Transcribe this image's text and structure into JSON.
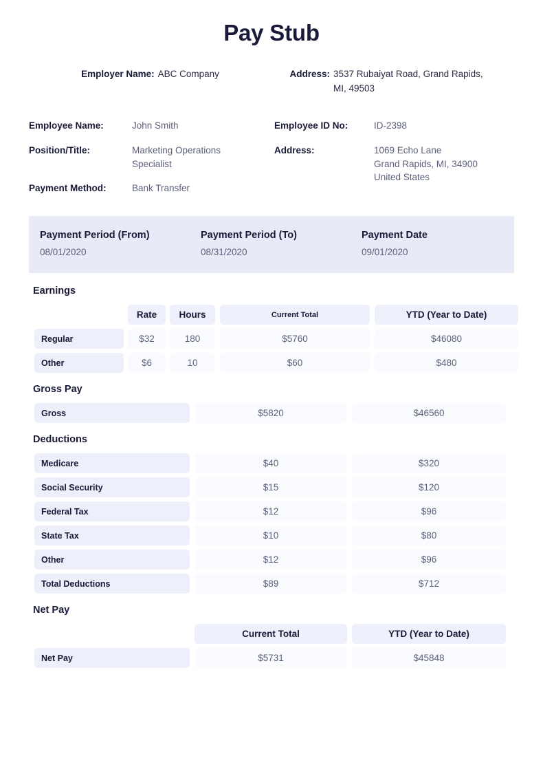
{
  "document": {
    "title": "Pay Stub"
  },
  "employer": {
    "name_label": "Employer Name:",
    "name_value": "ABC Company",
    "address_label": "Address:",
    "address_value": "3537 Rubaiyat Road, Grand Rapids, MI, 49503"
  },
  "employee": {
    "name_label": "Employee Name:",
    "name_value": "John Smith",
    "position_label": "Position/Title:",
    "position_value": "Marketing Operations Specialist",
    "payment_method_label": "Payment Method:",
    "payment_method_value": "Bank Transfer",
    "id_label": "Employee ID No:",
    "id_value": "ID-2398",
    "address_label": "Address:",
    "address_value": "1069 Echo Lane\nGrand Rapids, MI, 34900\nUnited States"
  },
  "period": {
    "from_label": "Payment Period (From)",
    "from_value": "08/01/2020",
    "to_label": "Payment Period (To)",
    "to_value": "08/31/2020",
    "date_label": "Payment Date",
    "date_value": "09/01/2020"
  },
  "earnings": {
    "heading": "Earnings",
    "headers": {
      "rate": "Rate",
      "hours": "Hours",
      "current_total": "Current Total",
      "ytd": "YTD (Year to Date)"
    },
    "rows": [
      {
        "label": "Regular",
        "rate": "$32",
        "hours": "180",
        "current_total": "$5760",
        "ytd": "$46080"
      },
      {
        "label": "Other",
        "rate": "$6",
        "hours": "10",
        "current_total": "$60",
        "ytd": "$480"
      }
    ]
  },
  "gross_pay": {
    "heading": "Gross Pay",
    "rows": [
      {
        "label": "Gross",
        "current_total": "$5820",
        "ytd": "$46560"
      }
    ]
  },
  "deductions": {
    "heading": "Deductions",
    "rows": [
      {
        "label": "Medicare",
        "current_total": "$40",
        "ytd": "$320"
      },
      {
        "label": "Social Security",
        "current_total": "$15",
        "ytd": "$120"
      },
      {
        "label": "Federal Tax",
        "current_total": "$12",
        "ytd": "$96"
      },
      {
        "label": "State Tax",
        "current_total": "$10",
        "ytd": "$80"
      },
      {
        "label": "Other",
        "current_total": "$12",
        "ytd": "$96"
      },
      {
        "label": "Total Deductions",
        "current_total": "$89",
        "ytd": "$712"
      }
    ]
  },
  "net_pay": {
    "heading": "Net Pay",
    "headers": {
      "current_total": "Current Total",
      "ytd": "YTD (Year to Date)"
    },
    "rows": [
      {
        "label": "Net Pay",
        "current_total": "$5731",
        "ytd": "$45848"
      }
    ]
  },
  "colors": {
    "text_dark": "#181a38",
    "text_muted": "#5c607a",
    "banner_bg": "#e8eaf7",
    "label_bg": "#edeffb",
    "head_bg": "#eef0fb",
    "value_bg": "#fafbfe",
    "page_bg": "#ffffff"
  }
}
